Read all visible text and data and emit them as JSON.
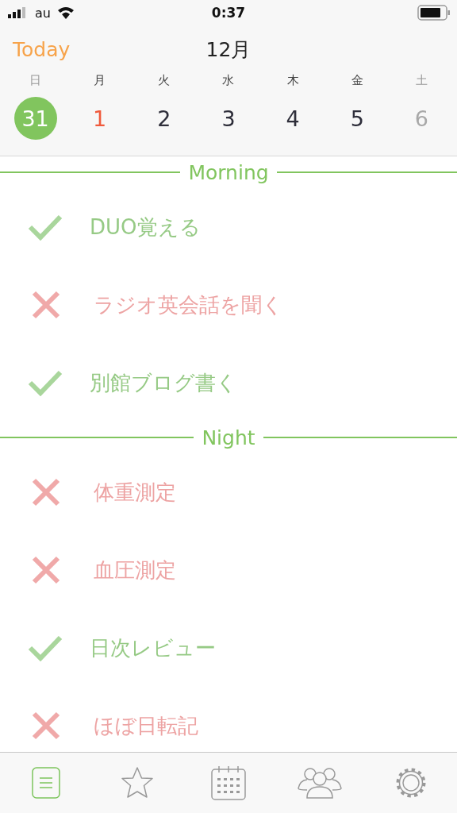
{
  "status_bar": {
    "carrier": "au",
    "time": "0:37"
  },
  "header": {
    "today_button": "Today",
    "month": "12月"
  },
  "week": [
    {
      "weekday": "日",
      "day": "31",
      "selected": true,
      "kind": "sunday"
    },
    {
      "weekday": "月",
      "day": "1",
      "selected": false,
      "kind": "holiday"
    },
    {
      "weekday": "火",
      "day": "2",
      "selected": false,
      "kind": "weekday"
    },
    {
      "weekday": "水",
      "day": "3",
      "selected": false,
      "kind": "weekday"
    },
    {
      "weekday": "木",
      "day": "4",
      "selected": false,
      "kind": "weekday"
    },
    {
      "weekday": "金",
      "day": "5",
      "selected": false,
      "kind": "weekday"
    },
    {
      "weekday": "土",
      "day": "6",
      "selected": false,
      "kind": "saturday"
    }
  ],
  "sections": [
    {
      "title": "Morning",
      "tasks": [
        {
          "label": "DUO覚える",
          "done": true
        },
        {
          "label": "ラジオ英会話を聞く",
          "done": false
        },
        {
          "label": "別館ブログ書く",
          "done": true
        }
      ]
    },
    {
      "title": "Night",
      "tasks": [
        {
          "label": "体重測定",
          "done": false
        },
        {
          "label": "血圧測定",
          "done": false
        },
        {
          "label": "日次レビュー",
          "done": true
        },
        {
          "label": "ほぼ日転記",
          "done": false
        }
      ]
    }
  ],
  "tab_bar": [
    {
      "kind": "list",
      "selected": true
    },
    {
      "kind": "star",
      "selected": false
    },
    {
      "kind": "calendar",
      "selected": false
    },
    {
      "kind": "people",
      "selected": false
    },
    {
      "kind": "settings",
      "selected": false
    }
  ]
}
